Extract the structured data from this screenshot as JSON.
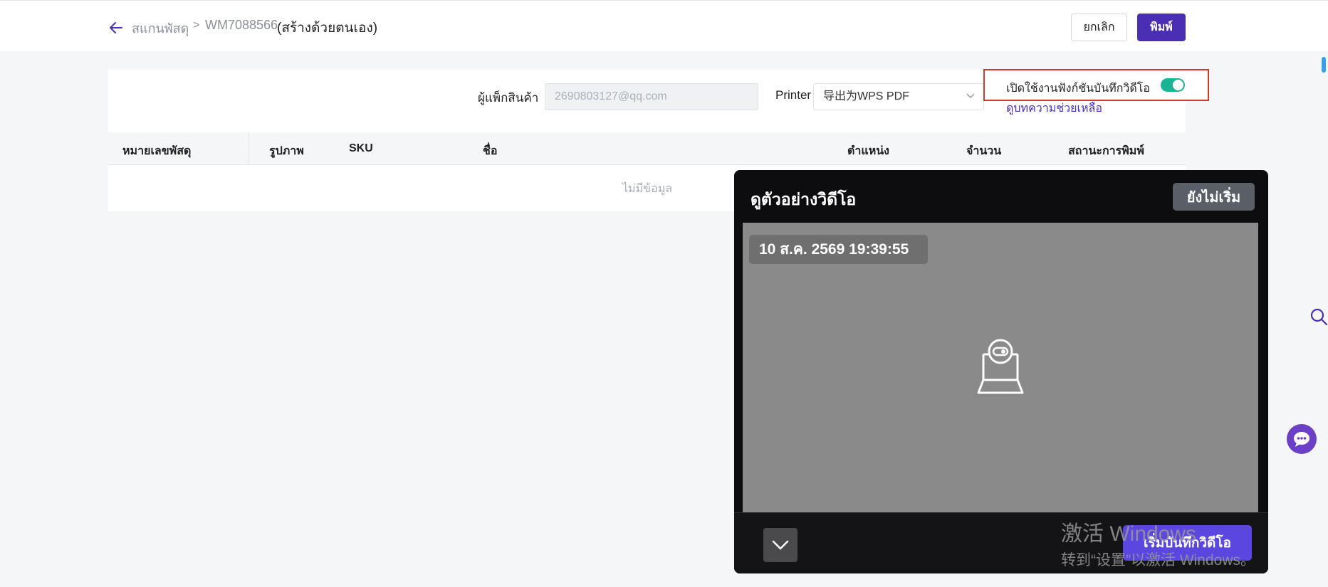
{
  "header": {
    "breadcrumb_root": "สแกนพัสดุ",
    "breadcrumb_separator": ">",
    "breadcrumb_id": "WM7088566",
    "breadcrumb_note": "(สร้างด้วยตนเอง)",
    "cancel_label": "ยกเลิก",
    "print_label": "พิมพ์"
  },
  "form": {
    "packer_label": "ผู้แพ็กสินค้า",
    "packer_value": "2690803127@qq.com",
    "printer_label": "Printer",
    "printer_value": "导出为WPS PDF",
    "video_toggle_label": "เปิดใช้งานฟังก์ชันบันทึกวิดีโอ",
    "video_toggle_on": true,
    "help_link": "ดูบทความช่วยเหลือ"
  },
  "table": {
    "columns": [
      "หมายเลขพัสดุ",
      "รูปภาพ",
      "SKU",
      "ชื่อ",
      "ตำแหน่ง",
      "จำนวน",
      "สถานะการพิมพ์"
    ],
    "empty_text": "ไม่มีข้อมูล"
  },
  "video_preview": {
    "title": "ดูตัวอย่างวิดีโอ",
    "status": "ยังไม่เริ่ม",
    "timestamp": "10 ส.ค. 2569 19:39:55",
    "record_label": "เริ่มบันทึกวิดีโอ"
  },
  "watermark": {
    "line1": "激活 Windows",
    "line2": "转到“设置”以激活 Windows。"
  },
  "colors": {
    "primary": "#4a2fb5",
    "toggle_on": "#1ab394",
    "highlight_border": "#d43a2a",
    "record_button": "#5b46e0"
  },
  "icons": [
    "arrow-left-icon",
    "chevron-down-icon",
    "camera-icon",
    "chevron-down-icon",
    "search-icon",
    "chat-icon"
  ]
}
